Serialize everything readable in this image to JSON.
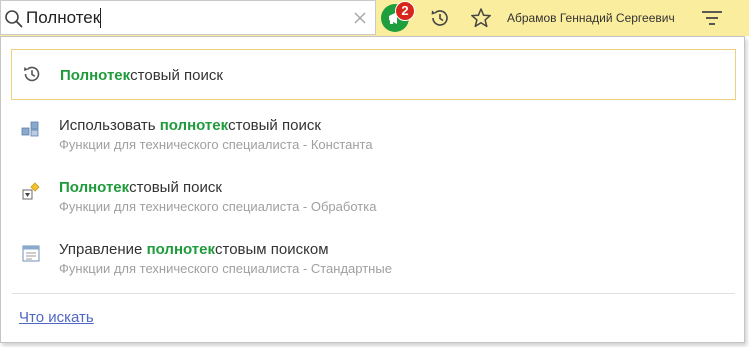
{
  "search": {
    "value": "Полнотек",
    "icon": "search-icon",
    "clear_icon": "close-icon"
  },
  "header": {
    "notifications_count": "2",
    "user_name": "Абрамов Геннадий Сергеевич",
    "colors": {
      "bar": "#fbed9e",
      "notify": "#1e9e3c",
      "badge": "#d7261c"
    }
  },
  "results": [
    {
      "icon": "history-icon",
      "highlight": "Полнотек",
      "rest": "стовый поиск",
      "subtitle": ""
    },
    {
      "icon": "constant-icon",
      "prefix": "Использовать ",
      "highlight": "полнотек",
      "rest": "стовый поиск",
      "subtitle": "Функции для технического специалиста - Константа"
    },
    {
      "icon": "data-processor-icon",
      "highlight": "Полнотек",
      "rest": "стовый поиск",
      "subtitle": "Функции для технического специалиста - Обработка"
    },
    {
      "icon": "form-window-icon",
      "prefix": "Управление ",
      "highlight": "полнотек",
      "rest": "стовым поиском",
      "subtitle": "Функции для технического специалиста - Стандартные"
    }
  ],
  "footer": {
    "link_label": "Что искать"
  },
  "highlight_color": "#1f9b3b"
}
